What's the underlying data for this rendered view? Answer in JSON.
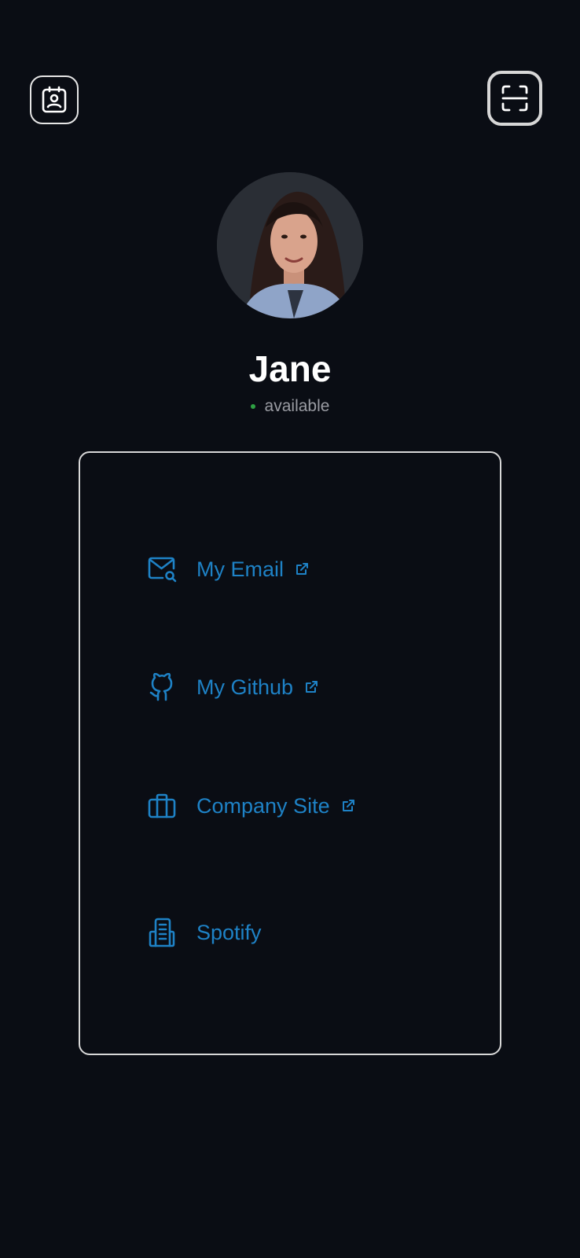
{
  "header": {
    "left_icon": "contact-card-icon",
    "right_icon": "scan-icon"
  },
  "profile": {
    "name": "Jane",
    "status": "available",
    "status_color": "#2ea043"
  },
  "links": [
    {
      "label": "My Email",
      "icon": "mail-search-icon",
      "external": true
    },
    {
      "label": "My Github",
      "icon": "github-icon",
      "external": true
    },
    {
      "label": "Company Site",
      "icon": "briefcase-icon",
      "external": true
    },
    {
      "label": "Spotify",
      "icon": "building-icon",
      "external": false
    }
  ],
  "colors": {
    "background": "#0a0d14",
    "link": "#1e82c6",
    "border": "#d8d8d8"
  }
}
